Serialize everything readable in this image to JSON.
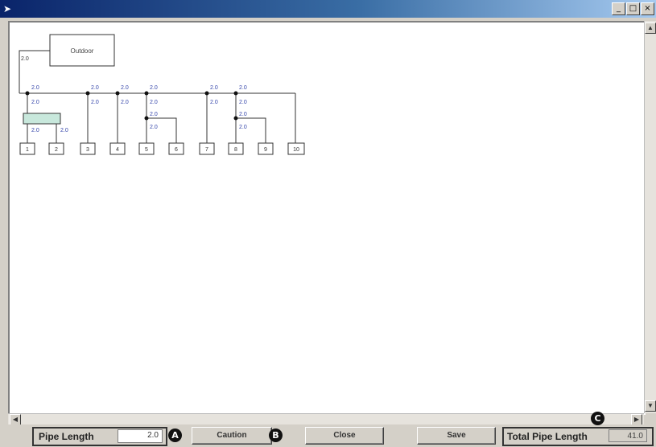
{
  "window": {
    "title_icon": "app-icon",
    "controls": {
      "minimize": "_",
      "maximize": "□",
      "close": "×"
    }
  },
  "diagram": {
    "outdoor_label": "Outdoor",
    "outdoor_length": "2.0",
    "branch_lengths": [
      "2.0",
      "2.0",
      "2.0",
      "2.0",
      "2.0",
      "2.0",
      "2.0",
      "2.0",
      "2.0",
      "2.0",
      "2.0",
      "2.0",
      "2.0",
      "2.0",
      "2.0",
      "2.0",
      "2.0",
      "2.0",
      "2.0"
    ],
    "units": [
      "1",
      "2",
      "3",
      "4",
      "5",
      "6",
      "7",
      "8",
      "9",
      "10"
    ]
  },
  "footer": {
    "pipe_length_label": "Pipe Length",
    "pipe_length_value": "2.0",
    "caution_label": "Caution",
    "close_label": "Close",
    "save_label": "Save",
    "total_label": "Total Pipe Length",
    "total_value": "41.0",
    "markers": {
      "a": "A",
      "b": "B",
      "c": "C"
    }
  }
}
